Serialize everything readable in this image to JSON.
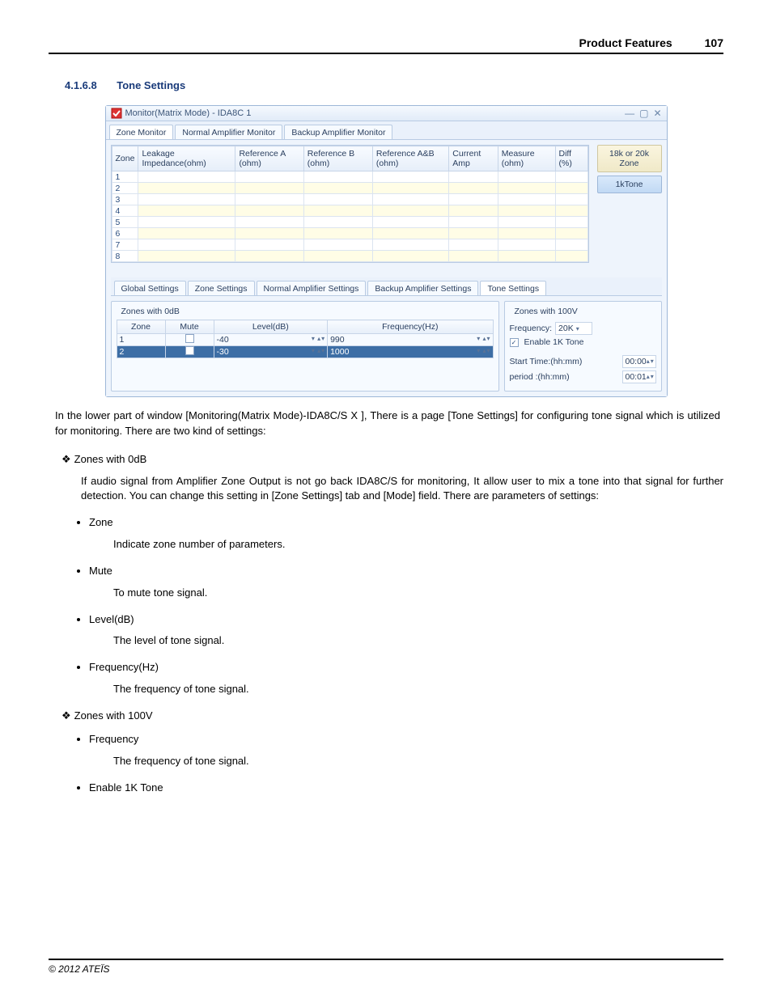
{
  "header": {
    "title": "Product Features",
    "page": "107"
  },
  "section": {
    "number": "4.1.6.8",
    "title": "Tone Settings"
  },
  "window": {
    "title": "Monitor(Matrix Mode) - IDA8C 1",
    "top_tabs": [
      "Zone Monitor",
      "Normal Amplifier Monitor",
      "Backup Amplifier Monitor"
    ],
    "grid_headers": [
      "Zone",
      "Leakage Impedance(ohm)",
      "Reference A (ohm)",
      "Reference B (ohm)",
      "Reference A&B (ohm)",
      "Current Amp",
      "Measure (ohm)",
      "Diff (%)"
    ],
    "zones": [
      "1",
      "2",
      "3",
      "4",
      "5",
      "6",
      "7",
      "8"
    ],
    "side_buttons": {
      "top": "18k or 20k Zone",
      "bottom": "1kTone"
    },
    "lower_tabs": [
      "Global Settings",
      "Zone Settings",
      "Normal Amplifier Settings",
      "Backup Amplifier Settings",
      "Tone Settings"
    ],
    "zones0db": {
      "legend": "Zones with 0dB",
      "headers": [
        "Zone",
        "Mute",
        "Level(dB)",
        "Frequency(Hz)"
      ],
      "rows": [
        {
          "zone": "1",
          "mute": false,
          "level": "-40",
          "freq": "990",
          "selected": false
        },
        {
          "zone": "2",
          "mute": false,
          "level": "-30",
          "freq": "1000",
          "selected": true
        }
      ]
    },
    "zones100v": {
      "legend": "Zones with 100V",
      "freq_label": "Frequency:",
      "freq_value": "20K",
      "enable_label": "Enable 1K Tone",
      "enable_checked": true,
      "start_label": "Start Time:(hh:mm)",
      "start_value": "00:00",
      "period_label": "period :(hh:mm)",
      "period_value": "00:01"
    }
  },
  "doc": {
    "intro": "In the lower part of window [Monitoring(Matrix Mode)-IDA8C/S X ], There is a page [Tone Settings] for configuring tone signal which is utilized for monitoring. There are two kind of settings:",
    "z0_title": "Zones with 0dB",
    "z0_desc": "If audio signal from Amplifier Zone Output is not go back IDA8C/S for monitoring, It allow user to mix a tone into that signal for further detection. You can change this setting in [Zone Settings] tab and [Mode] field. There are parameters of settings:",
    "z0_items": [
      {
        "name": "Zone",
        "desc": "Indicate zone number of parameters."
      },
      {
        "name": "Mute",
        "desc": "To mute tone signal."
      },
      {
        "name": "Level(dB)",
        "desc": "The level of tone signal."
      },
      {
        "name": "Frequency(Hz)",
        "desc": "The frequency of tone signal."
      }
    ],
    "z100_title": "Zones with 100V",
    "z100_items": [
      {
        "name": "Frequency",
        "desc": "The frequency of tone signal."
      },
      {
        "name": "Enable 1K Tone",
        "desc": ""
      }
    ]
  },
  "footer": "© 2012 ATEÏS"
}
